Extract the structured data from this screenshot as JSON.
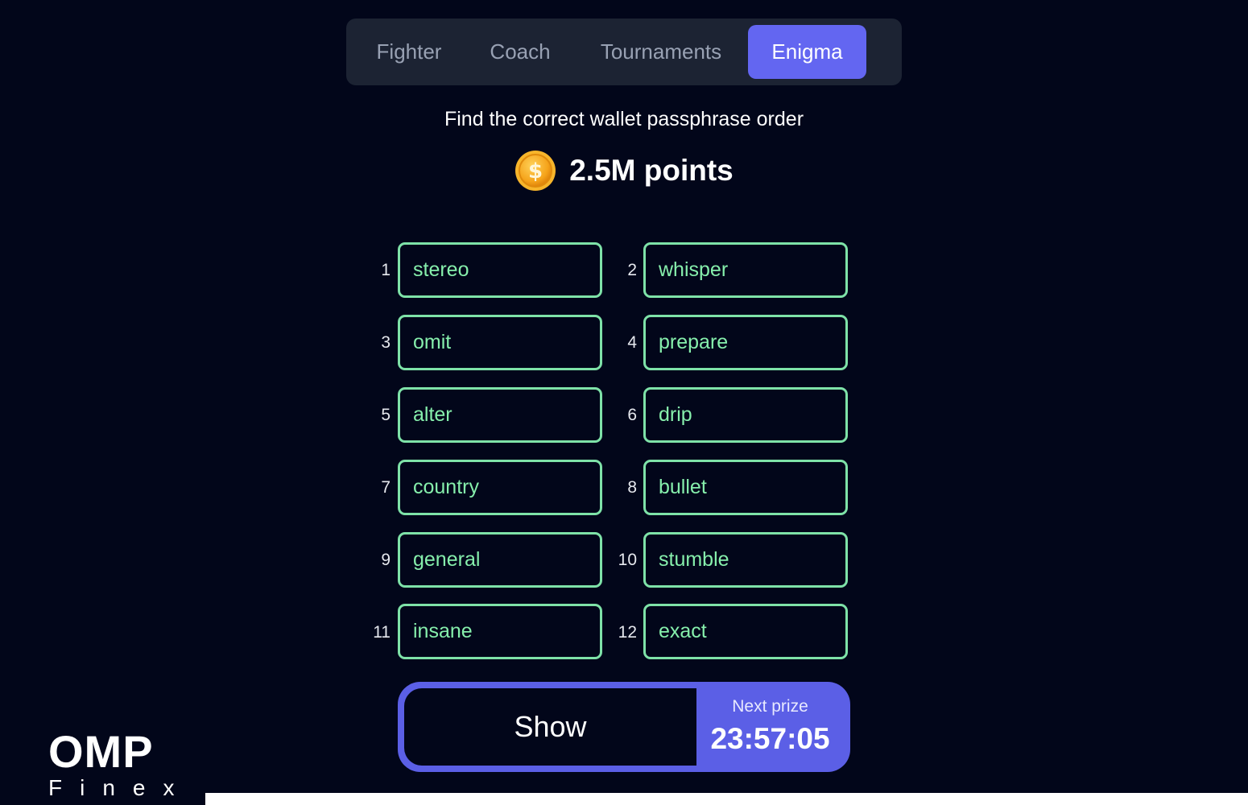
{
  "tabs": [
    {
      "label": "Fighter",
      "active": false
    },
    {
      "label": "Coach",
      "active": false
    },
    {
      "label": "Tournaments",
      "active": false
    },
    {
      "label": "Enigma",
      "active": true
    }
  ],
  "enigma": {
    "subtitle": "Find the correct wallet passphrase order",
    "points": "2.5M points",
    "coin_icon": "dollar-coin-icon"
  },
  "words": [
    {
      "num": "1",
      "word": "stereo"
    },
    {
      "num": "2",
      "word": "whisper"
    },
    {
      "num": "3",
      "word": "omit"
    },
    {
      "num": "4",
      "word": "prepare"
    },
    {
      "num": "5",
      "word": "alter"
    },
    {
      "num": "6",
      "word": "drip"
    },
    {
      "num": "7",
      "word": "country"
    },
    {
      "num": "8",
      "word": "bullet"
    },
    {
      "num": "9",
      "word": "general"
    },
    {
      "num": "10",
      "word": "stumble"
    },
    {
      "num": "11",
      "word": "insane"
    },
    {
      "num": "12",
      "word": "exact"
    }
  ],
  "action": {
    "show_label": "Show",
    "next_prize_label": "Next prize",
    "timer": "23:57:05"
  },
  "logo": {
    "main": "OMP",
    "sub": "Finex"
  },
  "colors": {
    "background": "#02061a",
    "accent": "#6366f1",
    "word_border": "#7ee2a8",
    "word_text": "#86efac",
    "tab_bar": "#1c2333",
    "coin": "#f59e0b"
  }
}
